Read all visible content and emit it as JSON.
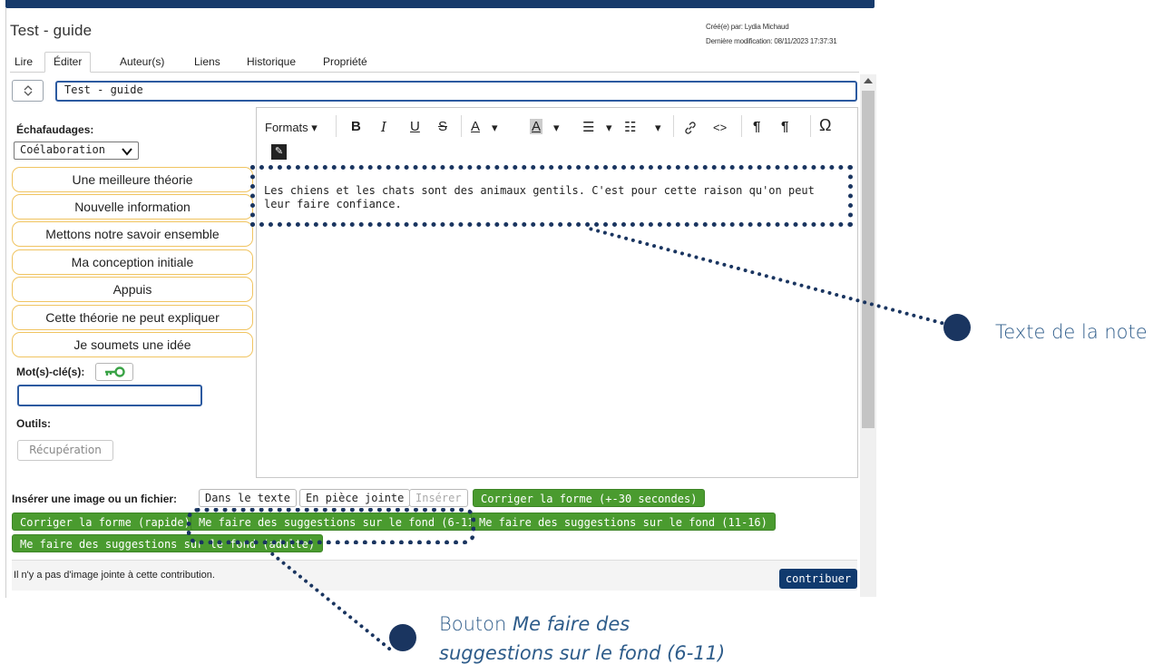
{
  "note": {
    "title": "Test - guide",
    "created_by": "Créé(e) par: Lydia Michaud",
    "last_modified": "Dernière modification: 08/11/2023 17:37:31",
    "title_value": "Test - guide"
  },
  "tabs": [
    {
      "label": "Lire"
    },
    {
      "label": "Éditer",
      "active": true
    },
    {
      "label": "Auteur(s)"
    },
    {
      "label": "Liens"
    },
    {
      "label": "Historique"
    },
    {
      "label": "Propriété"
    }
  ],
  "sidebar": {
    "scaffolds_label": "Échafaudages:",
    "scaffold_select": "Coélaboration",
    "scaffolds": [
      "Une meilleure théorie",
      "Nouvelle information",
      "Mettons notre savoir ensemble",
      "Ma conception initiale",
      "Appuis",
      "Cette théorie ne peut expliquer",
      "Je soumets une idée"
    ],
    "keywords_label": "Mot(s)-clé(s):",
    "tools_label": "Outils:",
    "recovery_button": "Récupération"
  },
  "editor": {
    "formats_label": "Formats ▾",
    "bold": "B",
    "italic": "I",
    "underline": "U",
    "strike": "S",
    "text_color": "A",
    "bg_color": "A",
    "caret": "▾",
    "bullet_list": "☰",
    "num_list": "☷",
    "link": "🔗",
    "code": "<>",
    "ltr": "¶",
    "rtl": "¶",
    "special_char": "Ω",
    "pen": "✎",
    "content": "Les chiens et les chats sont des animaux gentils. C'est pour cette raison qu'on peut leur faire confiance."
  },
  "insert": {
    "label": "Insérer une image ou un fichier:",
    "in_text": "Dans le texte",
    "attachment": "En pièce jointe",
    "insert": "Insérer",
    "correct_form_30": "Corriger la forme (+-30 secondes)",
    "correct_form_fast": "Corriger la forme (rapide)",
    "suggest_6_11": "Me faire des suggestions sur le fond (6-11)",
    "suggest_11_16": "Me faire des suggestions sur le fond (11-16)",
    "suggest_adult": "Me faire des suggestions sur le fond (adulte)"
  },
  "footer": {
    "no_image": "Il n'y a pas d'image jointe à cette contribution.",
    "contribute": "contribuer"
  },
  "annotations": {
    "note_text": "Texte de la note",
    "button_prefix": "Bouton ",
    "button_italic_1": "Me faire des",
    "button_italic_2": "suggestions sur le fond (6-11)"
  },
  "colors": {
    "accent_blue": "#2c5aa0",
    "navy": "#103a6e",
    "green": "#4a9b2f",
    "scaffold_border": "#f0c461",
    "annotation": "#1a3560"
  }
}
